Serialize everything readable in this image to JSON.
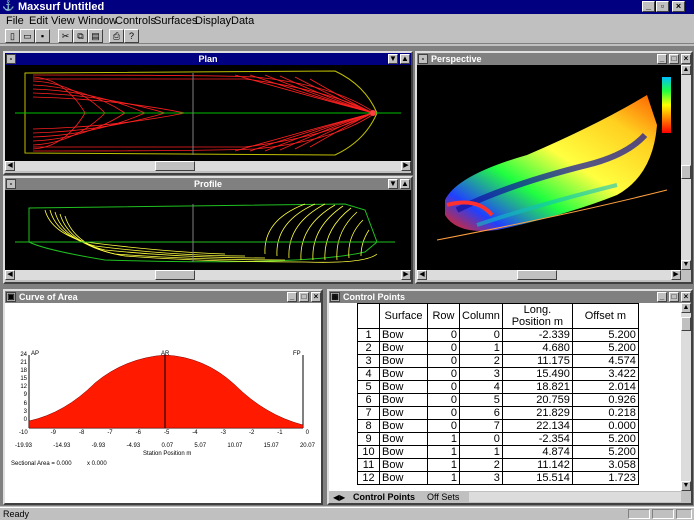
{
  "app": {
    "title": "Maxsurf Untitled"
  },
  "menu": [
    "File",
    "Edit",
    "View",
    "Window",
    "Controls",
    "Surfaces",
    "Display",
    "Data"
  ],
  "toolbar": {
    "icons": [
      "new-icon",
      "open-icon",
      "save-icon",
      "cut-icon",
      "copy-icon",
      "paste-icon",
      "print-icon",
      "help-icon"
    ]
  },
  "windows": {
    "plan": {
      "title": "Plan"
    },
    "profile": {
      "title": "Profile"
    },
    "perspective": {
      "title": "Perspective"
    },
    "curve": {
      "title": "Curve of Area",
      "ap": "AP",
      "fp": "FP",
      "peak": "AR",
      "y_ticks": [
        "24",
        "21",
        "18",
        "15",
        "12",
        "9",
        "6",
        "3",
        "0"
      ],
      "x_ticks_top": [
        "-10",
        "-9",
        "-8",
        "-7",
        "-6",
        "-5",
        "-4",
        "-3",
        "-2",
        "-1",
        "0"
      ],
      "x_ticks_bottom": [
        "-19.93",
        "-14.93",
        "-9.93",
        "-4.93",
        "0.07",
        "5.07",
        "10.07",
        "15.07",
        "20.07"
      ],
      "xlabel": "Station Position  m",
      "sectional_label": "Sectional Area = 0.000",
      "x_readout": "x  0.000"
    },
    "control_points": {
      "title": "Control Points",
      "columns": [
        "Surface",
        "Row",
        "Column",
        "Long. Position m",
        "Offset m"
      ],
      "rows": [
        [
          "1",
          "Bow",
          "0",
          "0",
          "-2.339",
          "5.200"
        ],
        [
          "2",
          "Bow",
          "0",
          "1",
          "4.680",
          "5.200"
        ],
        [
          "3",
          "Bow",
          "0",
          "2",
          "11.175",
          "4.574"
        ],
        [
          "4",
          "Bow",
          "0",
          "3",
          "15.490",
          "3.422"
        ],
        [
          "5",
          "Bow",
          "0",
          "4",
          "18.821",
          "2.014"
        ],
        [
          "6",
          "Bow",
          "0",
          "5",
          "20.759",
          "0.926"
        ],
        [
          "7",
          "Bow",
          "0",
          "6",
          "21.829",
          "0.218"
        ],
        [
          "8",
          "Bow",
          "0",
          "7",
          "22.134",
          "0.000"
        ],
        [
          "9",
          "Bow",
          "1",
          "0",
          "-2.354",
          "5.200"
        ],
        [
          "10",
          "Bow",
          "1",
          "1",
          "4.874",
          "5.200"
        ],
        [
          "11",
          "Bow",
          "1",
          "2",
          "11.142",
          "3.058"
        ],
        [
          "12",
          "Bow",
          "1",
          "3",
          "15.514",
          "1.723"
        ]
      ],
      "tabs": [
        "Control Points",
        "Off Sets"
      ]
    }
  },
  "status": {
    "text": "Ready"
  }
}
